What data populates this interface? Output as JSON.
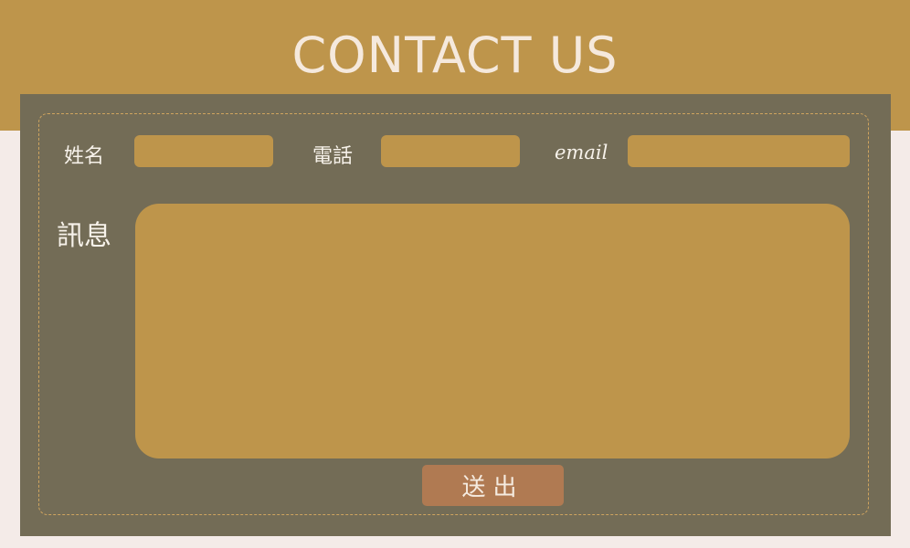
{
  "header": {
    "title": "CONTACT US"
  },
  "form": {
    "name_label": "姓名",
    "name_value": "",
    "phone_label": "電話",
    "phone_value": "",
    "email_label": "email",
    "email_value": "",
    "message_label": "訊息",
    "message_value": "",
    "submit_label": "送出"
  },
  "colors": {
    "header_band": "#be954b",
    "page_background": "#f4ebe8",
    "panel_background": "#736c56",
    "field_fill": "#be954b",
    "stitch_border": "#cfa45f",
    "submit_button": "#b07a52",
    "label_text": "#f7f2ea"
  }
}
